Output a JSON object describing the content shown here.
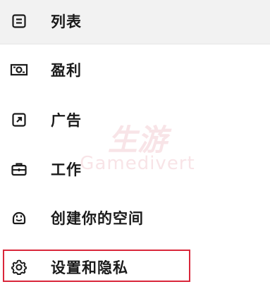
{
  "menu": {
    "items": [
      {
        "key": "list",
        "label": "列表",
        "icon": "list-icon"
      },
      {
        "key": "monetization",
        "label": "盈利",
        "icon": "money-icon"
      },
      {
        "key": "ads",
        "label": "广告",
        "icon": "ad-external-icon"
      },
      {
        "key": "work",
        "label": "工作",
        "icon": "briefcase-icon"
      },
      {
        "key": "create_space",
        "label": "创建你的空间",
        "icon": "smile-face-icon"
      },
      {
        "key": "settings_privacy",
        "label": "设置和隐私",
        "icon": "gear-icon"
      }
    ],
    "highlighted_item": "settings_privacy"
  },
  "watermark": {
    "line1": "生游",
    "line2": "Gamedivert"
  },
  "colors": {
    "highlight": "#d9263a",
    "top_band": "#f2f2f2",
    "text": "#1a1a1a"
  }
}
